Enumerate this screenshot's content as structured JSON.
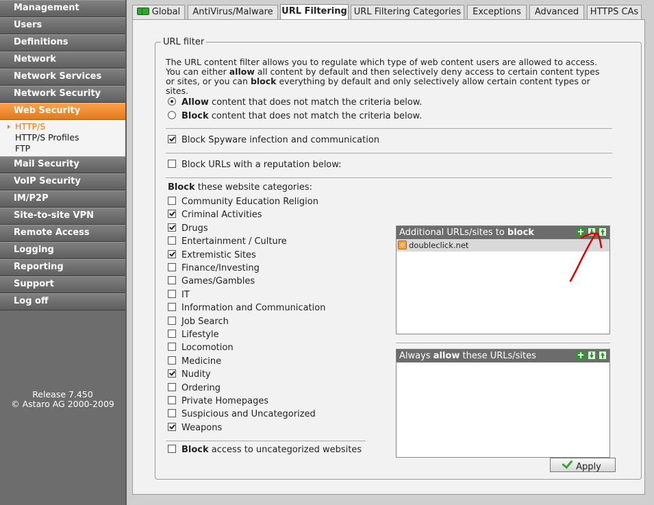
{
  "sidebar": {
    "items_top": [
      "Management",
      "Users",
      "Definitions",
      "Network",
      "Network Services",
      "Network Security"
    ],
    "active": "Web Security",
    "subitems": [
      "HTTP/S",
      "HTTP/S Profiles",
      "FTP"
    ],
    "items_bottom": [
      "Mail Security",
      "VoIP Security",
      "IM/P2P",
      "Site-to-site VPN",
      "Remote Access",
      "Logging",
      "Reporting",
      "Support",
      "Log off"
    ],
    "release": "Release 7.450",
    "copyright": "© Astaro AG 2000-2009"
  },
  "tabs": [
    "Global",
    "AntiVirus/Malware",
    "URL Filtering",
    "URL Filtering Categories",
    "Exceptions",
    "Advanced",
    "HTTPS CAs"
  ],
  "fieldset": {
    "legend": "URL filter",
    "intro": {
      "p1": "The URL content filter allows you to regulate which type of web content users are allowed to access. You can either ",
      "b1": "allow",
      "p2": " all content by default and then selectively deny access to certain content types or sites, or you can ",
      "b2": "block",
      "p3": " everything by default and only selectively allow certain content types or sites."
    },
    "radio_allow_bold": "Allow",
    "radio_allow_rest": " content that does not match the criteria below.",
    "radio_block_bold": "Block",
    "radio_block_rest": " content that does not match the criteria below.",
    "spyware_label": "Block Spyware infection and communication",
    "reputation_label": "Block URLs with a reputation below:",
    "categories_heading_bold": "Block",
    "categories_heading_rest": " these website categories:",
    "categories": [
      {
        "label": "Community Education Religion",
        "checked": false
      },
      {
        "label": "Criminal Activities",
        "checked": true
      },
      {
        "label": "Drugs",
        "checked": true
      },
      {
        "label": "Entertainment / Culture",
        "checked": false
      },
      {
        "label": "Extremistic Sites",
        "checked": true
      },
      {
        "label": "Finance/Investing",
        "checked": false
      },
      {
        "label": "Games/Gambles",
        "checked": false
      },
      {
        "label": "IT",
        "checked": false
      },
      {
        "label": "Information and Communication",
        "checked": false
      },
      {
        "label": "Job Search",
        "checked": false
      },
      {
        "label": "Lifestyle",
        "checked": false
      },
      {
        "label": "Locomotion",
        "checked": false
      },
      {
        "label": "Medicine",
        "checked": false
      },
      {
        "label": "Nudity",
        "checked": true
      },
      {
        "label": "Ordering",
        "checked": false
      },
      {
        "label": "Private Homepages",
        "checked": false
      },
      {
        "label": "Suspicious and Uncategorized",
        "checked": false
      },
      {
        "label": "Weapons",
        "checked": true
      }
    ],
    "uncategorized_bold": "Block",
    "uncategorized_rest": " access to uncategorized websites",
    "block_list": {
      "head_prefix": "Additional URLs/sites to ",
      "head_bold": "block",
      "items": [
        "doubleclick.net"
      ]
    },
    "allow_list": {
      "head_prefix": "Always ",
      "head_bold": "allow",
      "head_suffix": " these URLs/sites"
    },
    "apply_label": "Apply"
  },
  "colors": {
    "accent": "#e7781a",
    "annotation_arrow": "#e00000"
  }
}
